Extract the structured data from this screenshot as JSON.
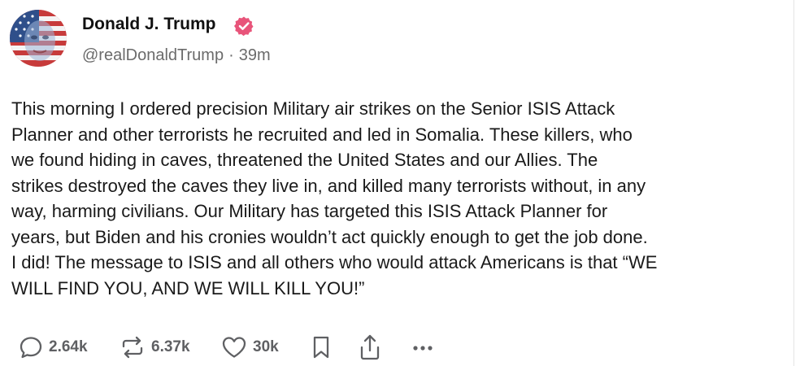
{
  "author": {
    "display_name": "Donald J. Trump",
    "handle": "@realDonaldTrump",
    "separator": "·",
    "timestamp": "39m",
    "verified_color": "#e8547a"
  },
  "post": {
    "lines": [
      "This morning I ordered precision Military air strikes on the Senior ISIS Attack",
      "Planner and other terrorists he recruited and led in Somalia. These killers, who",
      "we found hiding in caves, threatened the United States and our Allies. The",
      "strikes destroyed the caves they live in, and killed many terrorists without, in any",
      "way, harming civilians. Our Military has targeted this ISIS Attack Planner for",
      "years, but Biden and his cronies wouldn’t act quickly enough to get the job done.",
      "I did! The message to ISIS and all others who would attack Americans is that “WE",
      "WILL FIND YOU, AND WE WILL KILL YOU!”"
    ]
  },
  "actions": {
    "replies": "2.64k",
    "retruths": "6.37k",
    "likes": "30k",
    "icons": [
      "reply-icon",
      "retruth-icon",
      "heart-icon",
      "bookmark-icon",
      "share-icon",
      "more-icon"
    ]
  }
}
